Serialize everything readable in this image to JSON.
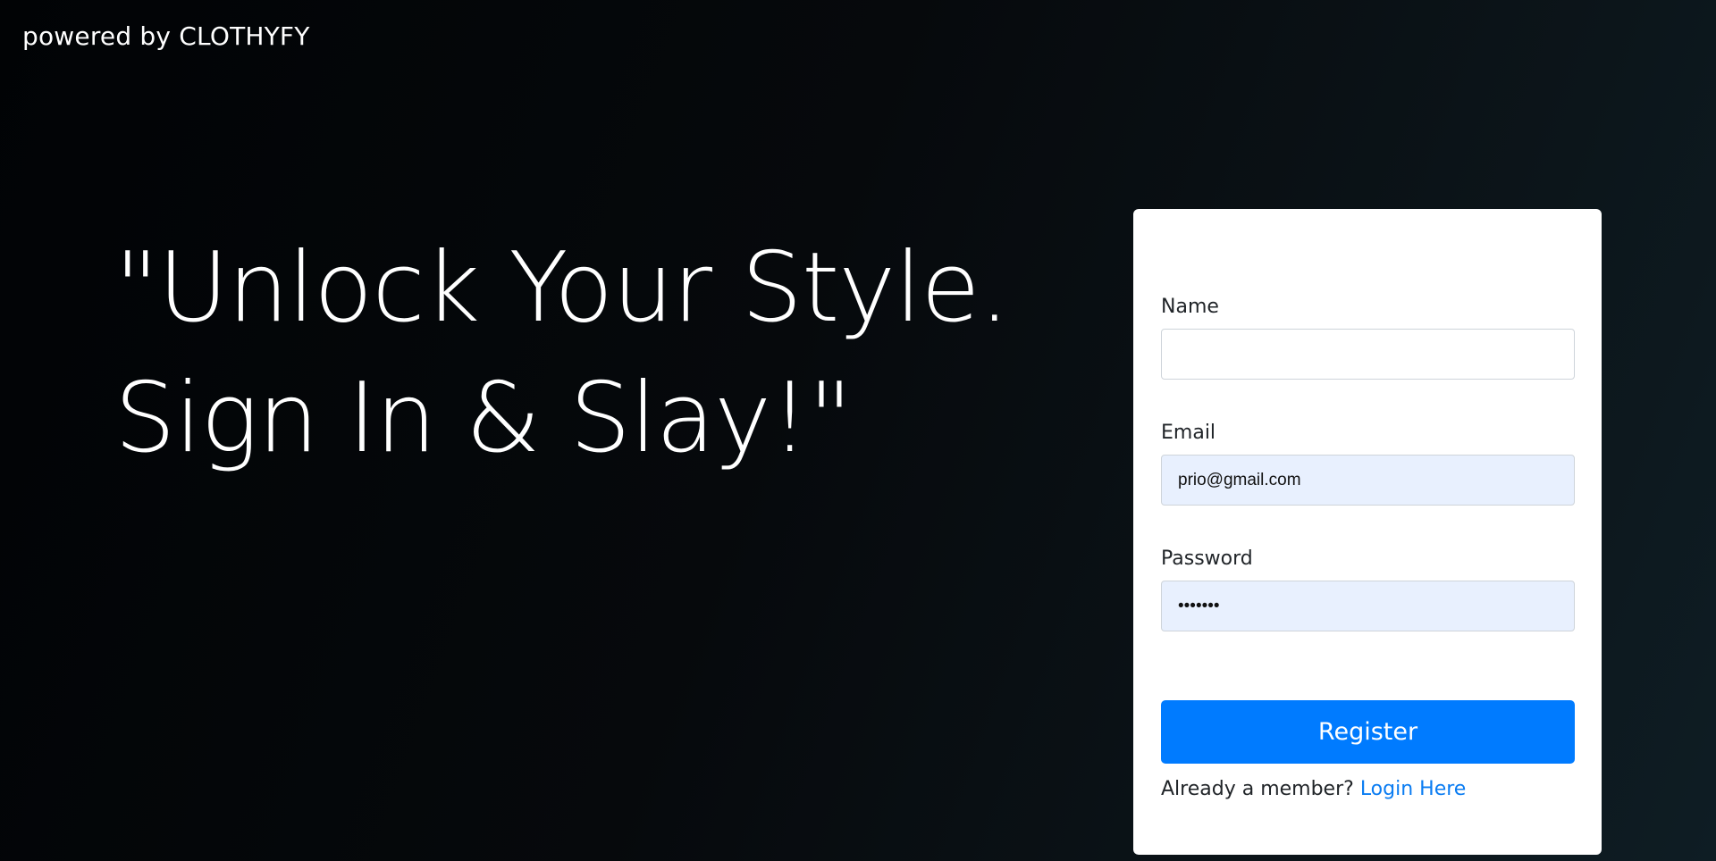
{
  "header": {
    "brand_text": "powered by CLOTHYFY"
  },
  "hero": {
    "line1": "\"Unlock Your Style.",
    "line2": "Sign In & Slay!\""
  },
  "form": {
    "name": {
      "label": "Name",
      "value": "",
      "placeholder": ""
    },
    "email": {
      "label": "Email",
      "value": "prio@gmail.com"
    },
    "password": {
      "label": "Password",
      "value": "•••••••"
    },
    "register_label": "Register",
    "login_prompt": "Already a member?",
    "login_link": "Login Here"
  },
  "colors": {
    "primary_button": "#007bff",
    "link": "#0a7cf2",
    "autofill_bg": "#e8f0fe",
    "card_bg": "#ffffff"
  }
}
